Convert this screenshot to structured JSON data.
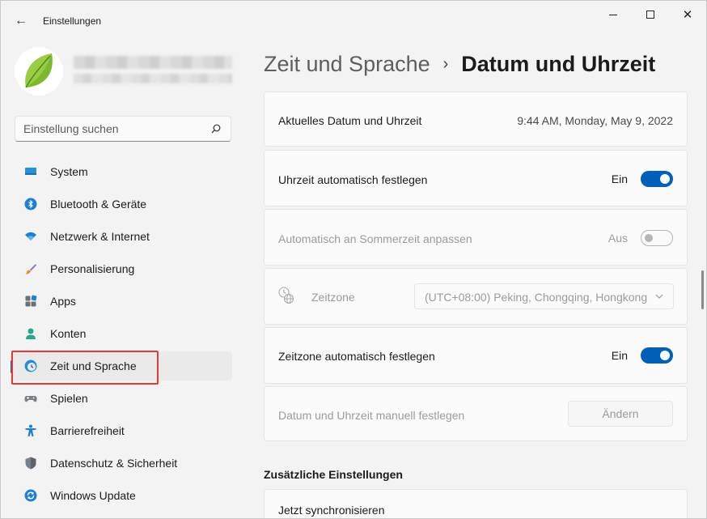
{
  "window": {
    "title": "Einstellungen"
  },
  "search": {
    "placeholder": "Einstellung suchen"
  },
  "nav": {
    "items": [
      {
        "label": "System",
        "icon": "monitor-icon"
      },
      {
        "label": "Bluetooth & Geräte",
        "icon": "bluetooth-icon"
      },
      {
        "label": "Netzwerk & Internet",
        "icon": "wifi-icon"
      },
      {
        "label": "Personalisierung",
        "icon": "brush-icon"
      },
      {
        "label": "Apps",
        "icon": "apps-icon"
      },
      {
        "label": "Konten",
        "icon": "person-icon"
      },
      {
        "label": "Zeit und Sprache",
        "icon": "clock-globe-icon",
        "active": true
      },
      {
        "label": "Spielen",
        "icon": "gamepad-icon"
      },
      {
        "label": "Barrierefreiheit",
        "icon": "accessibility-icon"
      },
      {
        "label": "Datenschutz & Sicherheit",
        "icon": "shield-icon"
      },
      {
        "label": "Windows Update",
        "icon": "update-icon"
      }
    ]
  },
  "header": {
    "parent": "Zeit und Sprache",
    "separator": "›",
    "current": "Datum und Uhrzeit"
  },
  "cards": {
    "current_datetime": {
      "label": "Aktuelles Datum und Uhrzeit",
      "value": "9:44 AM, Monday, May 9, 2022"
    },
    "auto_time": {
      "label": "Uhrzeit automatisch festlegen",
      "state_text": "Ein",
      "on": true
    },
    "dst": {
      "label": "Automatisch an Sommerzeit anpassen",
      "state_text": "Aus",
      "on": false
    },
    "timezone": {
      "label": "Zeitzone",
      "selected": "(UTC+08:00) Peking, Chongqing, Hongkong"
    },
    "auto_timezone": {
      "label": "Zeitzone automatisch festlegen",
      "state_text": "Ein",
      "on": true
    },
    "manual": {
      "label": "Datum und Uhrzeit manuell festlegen",
      "button": "Ändern"
    }
  },
  "additional": {
    "heading": "Zusätzliche Einstellungen",
    "sync_label": "Jetzt synchronisieren"
  },
  "colors": {
    "accent": "#005fb8",
    "highlight": "#e53935"
  }
}
